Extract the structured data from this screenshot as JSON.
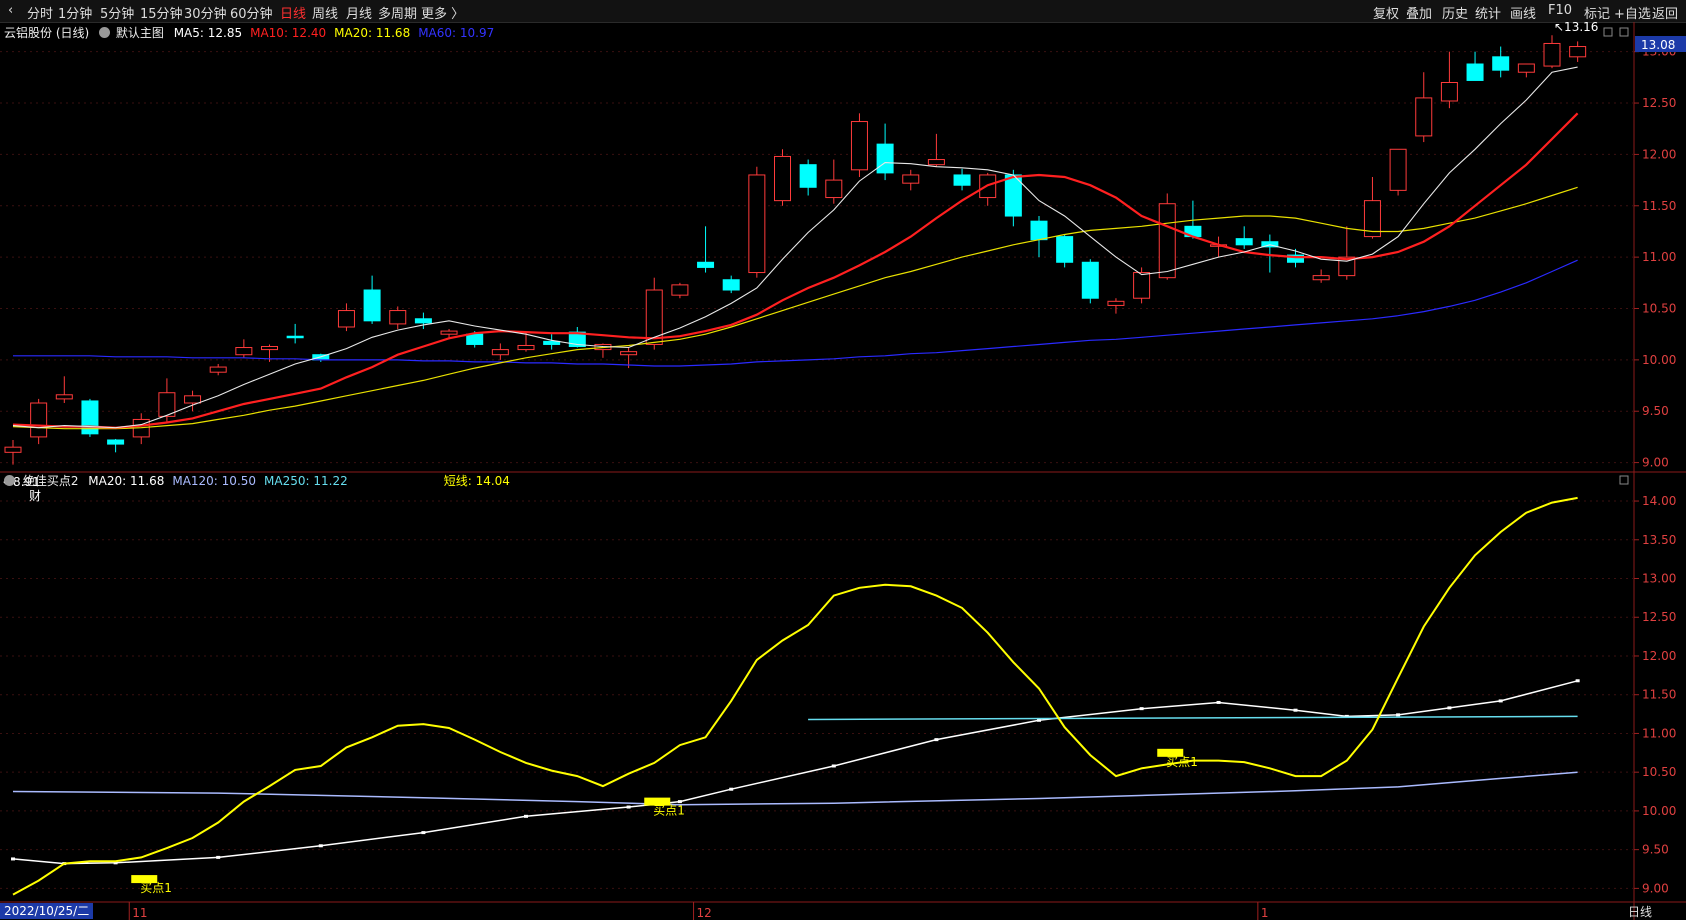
{
  "toolbar": {
    "left": [
      "分时",
      "1分钟",
      "5分钟",
      "15分钟",
      "30分钟",
      "60分钟",
      "日线",
      "周线",
      "月线",
      "多周期",
      "更多 〉"
    ],
    "active": "日线",
    "right": [
      "复权",
      "叠加",
      "历史",
      "统计",
      "画线",
      "F10",
      "标记",
      "+自选",
      "返回"
    ]
  },
  "main_panel": {
    "stock_label": "云铝股份 (日线)",
    "indicator_label": "默认主图",
    "ma_legend": [
      {
        "label": "MA5: 12.85",
        "color": "#ffffff"
      },
      {
        "label": "MA10: 12.40",
        "color": "#ff2020"
      },
      {
        "label": "MA20: 11.68",
        "color": "#ffff00"
      },
      {
        "label": "MA60: 10.97",
        "color": "#3333ff"
      }
    ],
    "price_badge": "13.08",
    "high_marker": "13.16",
    "low_marker": "8.91",
    "fin_marker": "财"
  },
  "sub_panel": {
    "indicator_label": "绝佳买点2",
    "legend": [
      {
        "label": "MA20: 11.68",
        "color": "#ffffff"
      },
      {
        "label": "MA120: 10.50",
        "color": "#aabbff"
      },
      {
        "label": "MA250: 11.22",
        "color": "#66ddee"
      },
      {
        "label": "短线: 14.04",
        "color": "#ffff00"
      }
    ],
    "buy_signals": [
      {
        "label": "买点1",
        "candle": 5,
        "y": 9.12
      },
      {
        "label": "买点1",
        "candle": 25,
        "y": 10.12
      },
      {
        "label": "买点1",
        "candle": 45,
        "y": 10.75
      }
    ]
  },
  "x_axis": {
    "date_label": "2022/10/25/二",
    "month_ticks": [
      {
        "label": "11",
        "candle": 5
      },
      {
        "label": "12",
        "candle": 27
      },
      {
        "label": "1",
        "candle": 49
      }
    ]
  },
  "bottom_label": "日线",
  "chart_data": [
    {
      "type": "candlestick",
      "title": "云铝股份 (日线)",
      "y_ticks": [
        9.0,
        9.5,
        10.0,
        10.5,
        11.0,
        11.5,
        12.0,
        12.5,
        13.0
      ],
      "ylim": [
        8.85,
        13.25
      ],
      "up_color": "#ff3b3b",
      "down_color": "#00ffff",
      "ohlc": [
        [
          9.1,
          9.22,
          8.98,
          9.15
        ],
        [
          9.25,
          9.62,
          9.18,
          9.58
        ],
        [
          9.62,
          9.84,
          9.58,
          9.66
        ],
        [
          9.6,
          9.62,
          9.25,
          9.28
        ],
        [
          9.22,
          9.23,
          9.1,
          9.18
        ],
        [
          9.25,
          9.48,
          9.18,
          9.42
        ],
        [
          9.45,
          9.82,
          9.4,
          9.68
        ],
        [
          9.58,
          9.7,
          9.5,
          9.65
        ],
        [
          9.88,
          9.96,
          9.85,
          9.93
        ],
        [
          10.05,
          10.2,
          10.02,
          10.12
        ],
        [
          10.1,
          10.15,
          9.98,
          10.13
        ],
        [
          10.23,
          10.35,
          10.16,
          10.22
        ],
        [
          10.05,
          10.06,
          9.98,
          10.0
        ],
        [
          10.32,
          10.55,
          10.28,
          10.48
        ],
        [
          10.68,
          10.82,
          10.35,
          10.38
        ],
        [
          10.35,
          10.52,
          10.3,
          10.48
        ],
        [
          10.4,
          10.46,
          10.3,
          10.36
        ],
        [
          10.25,
          10.3,
          10.2,
          10.28
        ],
        [
          10.25,
          10.28,
          10.12,
          10.15
        ],
        [
          10.05,
          10.16,
          10.0,
          10.1
        ],
        [
          10.1,
          10.28,
          10.08,
          10.14
        ],
        [
          10.18,
          10.25,
          10.1,
          10.15
        ],
        [
          10.27,
          10.32,
          10.12,
          10.13
        ],
        [
          10.1,
          10.16,
          10.02,
          10.15
        ],
        [
          10.05,
          10.12,
          9.92,
          10.08
        ],
        [
          10.15,
          10.8,
          10.1,
          10.68
        ],
        [
          10.63,
          10.75,
          10.6,
          10.73
        ],
        [
          10.95,
          11.3,
          10.85,
          10.9
        ],
        [
          10.78,
          10.82,
          10.65,
          10.68
        ],
        [
          10.85,
          11.88,
          10.8,
          11.8
        ],
        [
          11.55,
          12.05,
          11.5,
          11.98
        ],
        [
          11.9,
          11.95,
          11.6,
          11.68
        ],
        [
          11.58,
          11.95,
          11.52,
          11.75
        ],
        [
          11.85,
          12.4,
          11.78,
          12.32
        ],
        [
          12.1,
          12.3,
          11.75,
          11.82
        ],
        [
          11.72,
          11.85,
          11.65,
          11.8
        ],
        [
          11.9,
          12.2,
          11.88,
          11.95
        ],
        [
          11.8,
          11.86,
          11.65,
          11.7
        ],
        [
          11.58,
          11.82,
          11.5,
          11.8
        ],
        [
          11.8,
          11.85,
          11.3,
          11.4
        ],
        [
          11.35,
          11.4,
          11.0,
          11.17
        ],
        [
          11.2,
          11.22,
          10.9,
          10.95
        ],
        [
          10.95,
          10.98,
          10.55,
          10.6
        ],
        [
          10.53,
          10.6,
          10.45,
          10.57
        ],
        [
          10.6,
          10.9,
          10.55,
          10.85
        ],
        [
          10.8,
          11.62,
          10.78,
          11.52
        ],
        [
          11.3,
          11.55,
          11.18,
          11.2
        ],
        [
          11.12,
          11.2,
          11.0,
          11.12
        ],
        [
          11.18,
          11.3,
          11.08,
          11.12
        ],
        [
          11.15,
          11.22,
          10.85,
          11.1
        ],
        [
          11.02,
          11.08,
          10.9,
          10.95
        ],
        [
          10.78,
          10.88,
          10.75,
          10.82
        ],
        [
          10.82,
          11.3,
          10.78,
          11.0
        ],
        [
          11.2,
          11.78,
          11.18,
          11.55
        ],
        [
          11.65,
          12.05,
          11.6,
          12.05
        ],
        [
          12.18,
          12.8,
          12.12,
          12.55
        ],
        [
          12.52,
          13.0,
          12.45,
          12.7
        ],
        [
          12.88,
          13.0,
          12.72,
          12.72
        ],
        [
          12.95,
          13.05,
          12.75,
          12.82
        ],
        [
          12.8,
          12.88,
          12.75,
          12.88
        ],
        [
          12.86,
          13.16,
          12.84,
          13.08
        ],
        [
          12.95,
          13.1,
          12.9,
          13.05
        ]
      ],
      "ma5": [
        9.36,
        9.34,
        9.36,
        9.35,
        9.34,
        9.37,
        9.46,
        9.56,
        9.65,
        9.76,
        9.86,
        9.96,
        10.03,
        10.11,
        10.22,
        10.29,
        10.34,
        10.38,
        10.33,
        10.29,
        10.25,
        10.19,
        10.15,
        10.13,
        10.12,
        10.22,
        10.31,
        10.42,
        10.55,
        10.7,
        10.98,
        11.24,
        11.46,
        11.74,
        11.92,
        11.91,
        11.88,
        11.87,
        11.85,
        11.8,
        11.55,
        11.4,
        11.2,
        11.0,
        10.83,
        10.86,
        10.93,
        11.0,
        11.05,
        11.12,
        11.06,
        10.98,
        10.96,
        11.03,
        11.2,
        11.52,
        11.82,
        12.05,
        12.3,
        12.53,
        12.8,
        12.85
      ],
      "ma10": [
        9.37,
        9.36,
        9.35,
        9.35,
        9.34,
        9.36,
        9.39,
        9.43,
        9.5,
        9.57,
        9.62,
        9.67,
        9.72,
        9.83,
        9.93,
        10.05,
        10.13,
        10.21,
        10.26,
        10.28,
        10.27,
        10.26,
        10.26,
        10.24,
        10.22,
        10.21,
        10.23,
        10.28,
        10.34,
        10.44,
        10.58,
        10.7,
        10.8,
        10.92,
        11.05,
        11.2,
        11.38,
        11.55,
        11.7,
        11.78,
        11.8,
        11.78,
        11.7,
        11.58,
        11.4,
        11.3,
        11.2,
        11.12,
        11.05,
        11.02,
        11.0,
        11.0,
        10.98,
        11.0,
        11.05,
        11.15,
        11.3,
        11.5,
        11.7,
        11.9,
        12.15,
        12.4
      ],
      "ma20": [
        9.35,
        9.34,
        9.33,
        9.33,
        9.33,
        9.34,
        9.36,
        9.38,
        9.42,
        9.46,
        9.51,
        9.55,
        9.6,
        9.65,
        9.7,
        9.75,
        9.8,
        9.86,
        9.92,
        9.97,
        10.02,
        10.06,
        10.1,
        10.12,
        10.14,
        10.17,
        10.2,
        10.25,
        10.32,
        10.4,
        10.48,
        10.56,
        10.64,
        10.72,
        10.8,
        10.86,
        10.93,
        11.0,
        11.06,
        11.12,
        11.17,
        11.22,
        11.26,
        11.28,
        11.3,
        11.33,
        11.36,
        11.38,
        11.4,
        11.4,
        11.38,
        11.33,
        11.28,
        11.25,
        11.25,
        11.28,
        11.33,
        11.38,
        11.45,
        11.52,
        11.6,
        11.68
      ],
      "ma60": [
        10.04,
        10.04,
        10.04,
        10.04,
        10.03,
        10.03,
        10.03,
        10.02,
        10.02,
        10.02,
        10.01,
        10.01,
        10.0,
        10.0,
        10.0,
        10.0,
        9.99,
        9.99,
        9.98,
        9.98,
        9.97,
        9.97,
        9.96,
        9.96,
        9.95,
        9.94,
        9.94,
        9.95,
        9.96,
        9.98,
        9.99,
        10.0,
        10.01,
        10.03,
        10.04,
        10.06,
        10.07,
        10.09,
        10.11,
        10.13,
        10.15,
        10.17,
        10.19,
        10.2,
        10.22,
        10.24,
        10.26,
        10.28,
        10.3,
        10.32,
        10.34,
        10.36,
        10.38,
        10.4,
        10.43,
        10.47,
        10.52,
        10.58,
        10.66,
        10.75,
        10.86,
        10.97
      ]
    },
    {
      "type": "line",
      "title": "绝佳买点2",
      "y_ticks": [
        9.0,
        9.5,
        10.0,
        10.5,
        11.0,
        11.5,
        12.0,
        12.5,
        13.0,
        13.5,
        14.0
      ],
      "ylim": [
        8.85,
        14.22
      ],
      "series": [
        {
          "name": "MA20",
          "color": "#ffffff",
          "points": [
            [
              0,
              9.38
            ],
            [
              2,
              9.32
            ],
            [
              4,
              9.33
            ],
            [
              8,
              9.4
            ],
            [
              12,
              9.55
            ],
            [
              16,
              9.72
            ],
            [
              20,
              9.93
            ],
            [
              24,
              10.05
            ],
            [
              26,
              10.12
            ],
            [
              28,
              10.28
            ],
            [
              32,
              10.58
            ],
            [
              36,
              10.92
            ],
            [
              40,
              11.17
            ],
            [
              44,
              11.32
            ],
            [
              47,
              11.4
            ],
            [
              50,
              11.3
            ],
            [
              52,
              11.22
            ],
            [
              54,
              11.24
            ],
            [
              56,
              11.33
            ],
            [
              58,
              11.42
            ],
            [
              61,
              11.68
            ]
          ]
        },
        {
          "name": "MA120",
          "color": "#aabbff",
          "points": [
            [
              0,
              10.25
            ],
            [
              8,
              10.23
            ],
            [
              16,
              10.17
            ],
            [
              22,
              10.12
            ],
            [
              26,
              10.08
            ],
            [
              32,
              10.1
            ],
            [
              40,
              10.16
            ],
            [
              46,
              10.22
            ],
            [
              50,
              10.26
            ],
            [
              54,
              10.31
            ],
            [
              58,
              10.42
            ],
            [
              61,
              10.5
            ]
          ]
        },
        {
          "name": "MA250",
          "color": "#66ddee",
          "points": [
            [
              31,
              11.18
            ],
            [
              61,
              11.22
            ]
          ]
        },
        {
          "name": "短线",
          "color": "#ffff00",
          "points": [
            [
              0,
              8.92
            ],
            [
              1,
              9.1
            ],
            [
              2,
              9.32
            ],
            [
              3,
              9.35
            ],
            [
              4,
              9.35
            ],
            [
              5,
              9.4
            ],
            [
              6,
              9.52
            ],
            [
              7,
              9.65
            ],
            [
              8,
              9.85
            ],
            [
              9,
              10.12
            ],
            [
              10,
              10.32
            ],
            [
              11,
              10.53
            ],
            [
              12,
              10.58
            ],
            [
              13,
              10.82
            ],
            [
              14,
              10.95
            ],
            [
              15,
              11.1
            ],
            [
              16,
              11.12
            ],
            [
              17,
              11.07
            ],
            [
              18,
              10.92
            ],
            [
              19,
              10.76
            ],
            [
              20,
              10.62
            ],
            [
              21,
              10.52
            ],
            [
              22,
              10.45
            ],
            [
              23,
              10.32
            ],
            [
              24,
              10.48
            ],
            [
              25,
              10.62
            ],
            [
              26,
              10.85
            ],
            [
              27,
              10.95
            ],
            [
              28,
              11.42
            ],
            [
              29,
              11.95
            ],
            [
              30,
              12.2
            ],
            [
              31,
              12.4
            ],
            [
              32,
              12.78
            ],
            [
              33,
              12.88
            ],
            [
              34,
              12.92
            ],
            [
              35,
              12.9
            ],
            [
              36,
              12.78
            ],
            [
              37,
              12.62
            ],
            [
              38,
              12.3
            ],
            [
              39,
              11.92
            ],
            [
              40,
              11.58
            ],
            [
              41,
              11.08
            ],
            [
              42,
              10.72
            ],
            [
              43,
              10.45
            ],
            [
              44,
              10.55
            ],
            [
              45,
              10.6
            ],
            [
              46,
              10.65
            ],
            [
              47,
              10.65
            ],
            [
              48,
              10.63
            ],
            [
              49,
              10.55
            ],
            [
              50,
              10.45
            ],
            [
              51,
              10.45
            ],
            [
              52,
              10.65
            ],
            [
              53,
              11.05
            ],
            [
              54,
              11.72
            ],
            [
              55,
              12.38
            ],
            [
              56,
              12.88
            ],
            [
              57,
              13.3
            ],
            [
              58,
              13.6
            ],
            [
              59,
              13.85
            ],
            [
              60,
              13.98
            ],
            [
              61,
              14.04
            ]
          ]
        }
      ]
    }
  ]
}
